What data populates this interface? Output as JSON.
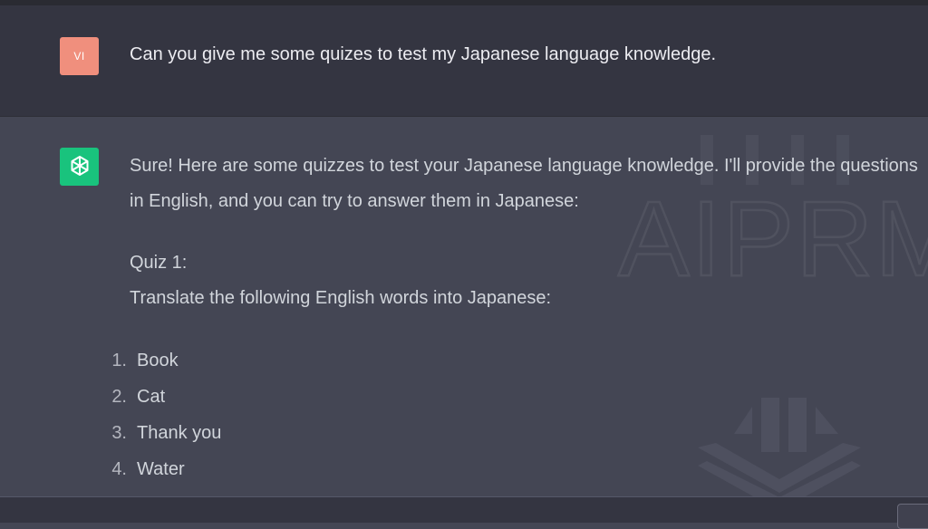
{
  "user_message": {
    "avatar_initials": "VI",
    "avatar_color": "#f08f7d",
    "text": "Can you give me some quizes to test my Japanese language knowledge."
  },
  "assistant_message": {
    "avatar_icon": "openai-logo-icon",
    "avatar_color": "#19c37d",
    "intro": "Sure! Here are some quizzes to test your Japanese language knowledge. I'll provide the questions in English, and you can try to answer them in Japanese:",
    "quiz_title": "Quiz 1:",
    "quiz_instruction": "Translate the following English words into Japanese:",
    "items": [
      {
        "number": "1.",
        "label": "Book"
      },
      {
        "number": "2.",
        "label": "Cat"
      },
      {
        "number": "3.",
        "label": "Thank you"
      },
      {
        "number": "4.",
        "label": "Water"
      }
    ]
  },
  "watermark": {
    "text": "AIPRM",
    "icon": "aiprm-logo-icon"
  }
}
